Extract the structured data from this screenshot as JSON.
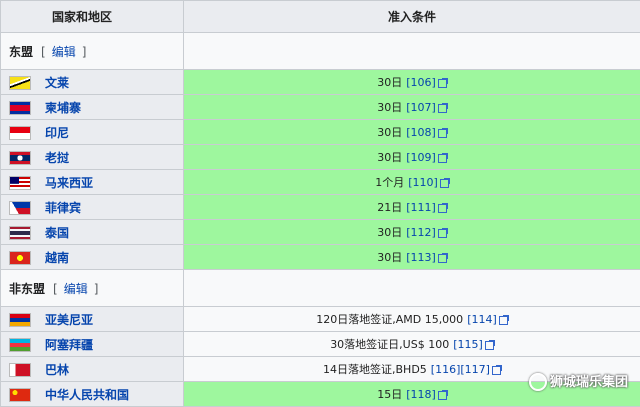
{
  "header": {
    "col1": "国家和地区",
    "col2": "准入条件"
  },
  "sections": [
    {
      "title": "东盟",
      "edit": "编辑",
      "edit_open": "[",
      "edit_close": "]",
      "rows": [
        {
          "country": "文莱",
          "flag": "brunei-flag",
          "condition": "30日",
          "ref": "[106]",
          "green": true
        },
        {
          "country": "柬埔寨",
          "flag": "cambodia-flag",
          "condition": "30日",
          "ref": "[107]",
          "green": true
        },
        {
          "country": "印尼",
          "flag": "indonesia-flag",
          "condition": "30日",
          "ref": "[108]",
          "green": true
        },
        {
          "country": "老挝",
          "flag": "laos-flag",
          "condition": "30日",
          "ref": "[109]",
          "green": true
        },
        {
          "country": "马来西亚",
          "flag": "malaysia-flag",
          "condition": "1个月",
          "ref": "[110]",
          "green": true
        },
        {
          "country": "菲律宾",
          "flag": "philippines-flag",
          "condition": "21日",
          "ref": "[111]",
          "green": true
        },
        {
          "country": "泰国",
          "flag": "thailand-flag",
          "condition": "30日",
          "ref": "[112]",
          "green": true
        },
        {
          "country": "越南",
          "flag": "vietnam-flag",
          "condition": "30日",
          "ref": "[113]",
          "green": true
        }
      ]
    },
    {
      "title": "非东盟",
      "edit": "编辑",
      "edit_open": "[",
      "edit_close": "]",
      "rows": [
        {
          "country": "亚美尼亚",
          "flag": "armenia-flag",
          "condition": "120日落地签证,AMD 15,000",
          "ref": "[114]",
          "green": false
        },
        {
          "country": "阿塞拜疆",
          "flag": "azerbaijan-flag",
          "condition": "30落地签证日,US$ 100",
          "ref": "[115]",
          "green": false
        },
        {
          "country": "巴林",
          "flag": "bahrain-flag",
          "condition": "14日落地签证,BHD5",
          "ref": "[116][117]",
          "green": false
        },
        {
          "country": "中华人民共和国",
          "flag": "china-flag",
          "condition": "15日",
          "ref": "[118]",
          "green": true
        }
      ]
    }
  ],
  "watermark": "狮城瑞乐集团"
}
